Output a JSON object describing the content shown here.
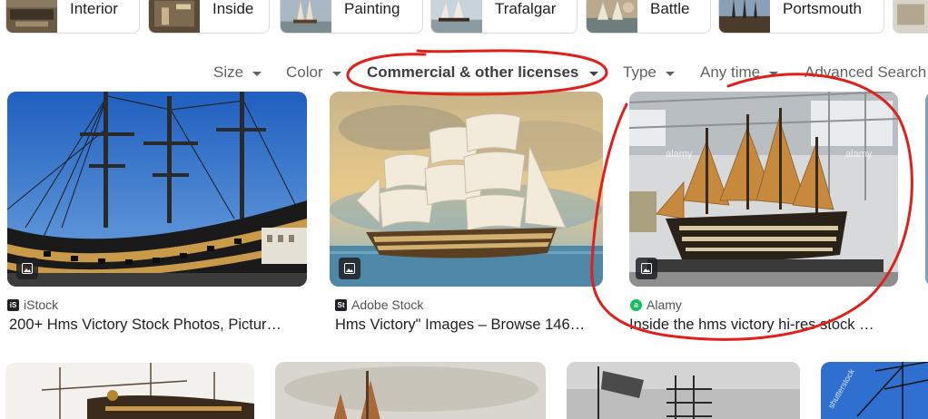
{
  "related_chips": [
    {
      "label": "Interior"
    },
    {
      "label": "Inside"
    },
    {
      "label": "Painting"
    },
    {
      "label": "Trafalgar"
    },
    {
      "label": "Battle"
    },
    {
      "label": "Portsmouth"
    }
  ],
  "filters": {
    "size": "Size",
    "color": "Color",
    "license": "Commercial & other licenses",
    "type": "Type",
    "time": "Any time",
    "advanced": "Advanced Search"
  },
  "results": [
    {
      "source": "iStock",
      "favicon_text": "iS",
      "favicon_color": "#202124",
      "title": "200+ Hms Victory Stock Photos, Pictur…"
    },
    {
      "source": "Adobe Stock",
      "favicon_text": "St",
      "favicon_color": "#202124",
      "title": "Hms Victory\" Images – Browse 146…"
    },
    {
      "source": "Alamy",
      "favicon_text": "a",
      "favicon_color": "#11c05a",
      "title": "Inside the hms victory hi-res stock …"
    }
  ],
  "image_watermarks": {
    "alamy_1": "alamy",
    "alamy_2": "alamy",
    "shutterstock": "shutterstock"
  },
  "annotation_color": "#e0201a",
  "icons": {
    "image_badge": "image-icon",
    "filter_caret": "caret-down-icon"
  }
}
